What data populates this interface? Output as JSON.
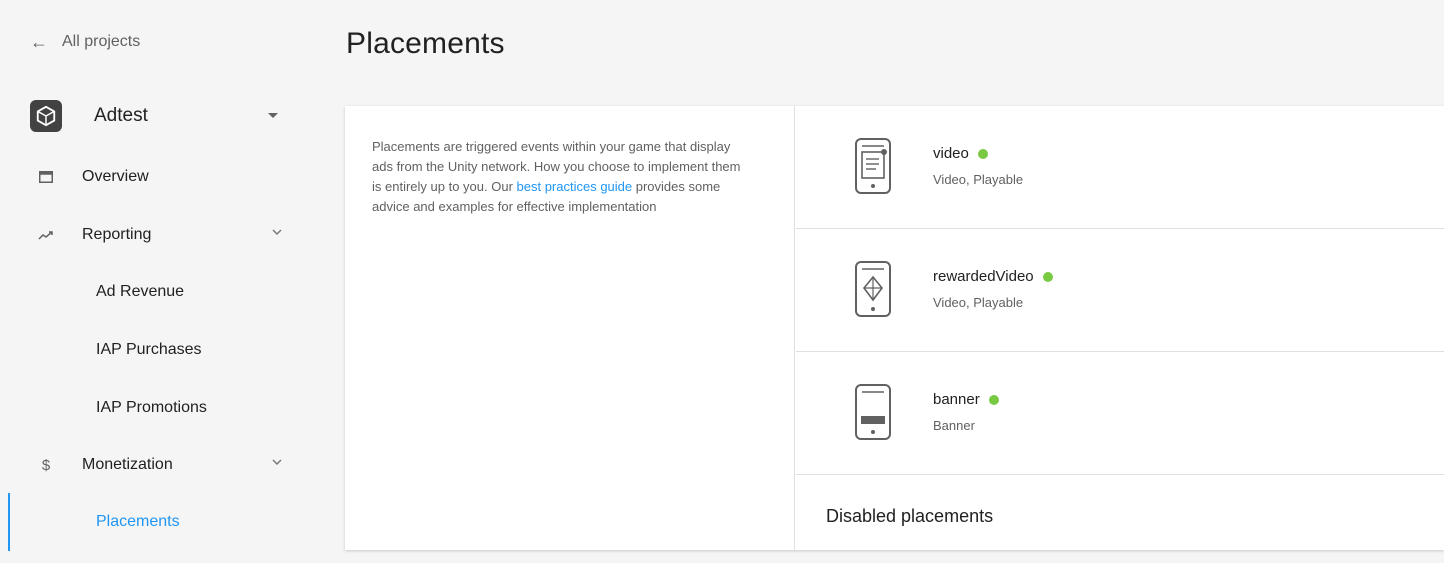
{
  "sidebar": {
    "back_label": "All projects",
    "project_name": "Adtest",
    "items": [
      {
        "label": "Overview"
      },
      {
        "label": "Reporting"
      },
      {
        "label": "Ad Revenue"
      },
      {
        "label": "IAP Purchases"
      },
      {
        "label": "IAP Promotions"
      },
      {
        "label": "Monetization"
      },
      {
        "label": "Placements"
      }
    ],
    "monetization_icon": "$"
  },
  "main": {
    "title": "Placements",
    "description": {
      "before": "Placements are triggered events within your game that display ads from the Unity network. How you choose to implement them is entirely up to you. Our ",
      "link": "best practices guide",
      "after": " provides some advice and examples for effective implementation"
    },
    "placements": [
      {
        "name": "video",
        "types": "Video, Playable",
        "icon": "phone-video-icon"
      },
      {
        "name": "rewardedVideo",
        "types": "Video, Playable",
        "icon": "phone-rewarded-icon"
      },
      {
        "name": "banner",
        "types": "Banner",
        "icon": "phone-banner-icon"
      }
    ],
    "disabled_title": "Disabled placements"
  },
  "colors": {
    "accent": "#2196f3",
    "status_enabled": "#7ac943",
    "background": "#f5f5f5"
  }
}
